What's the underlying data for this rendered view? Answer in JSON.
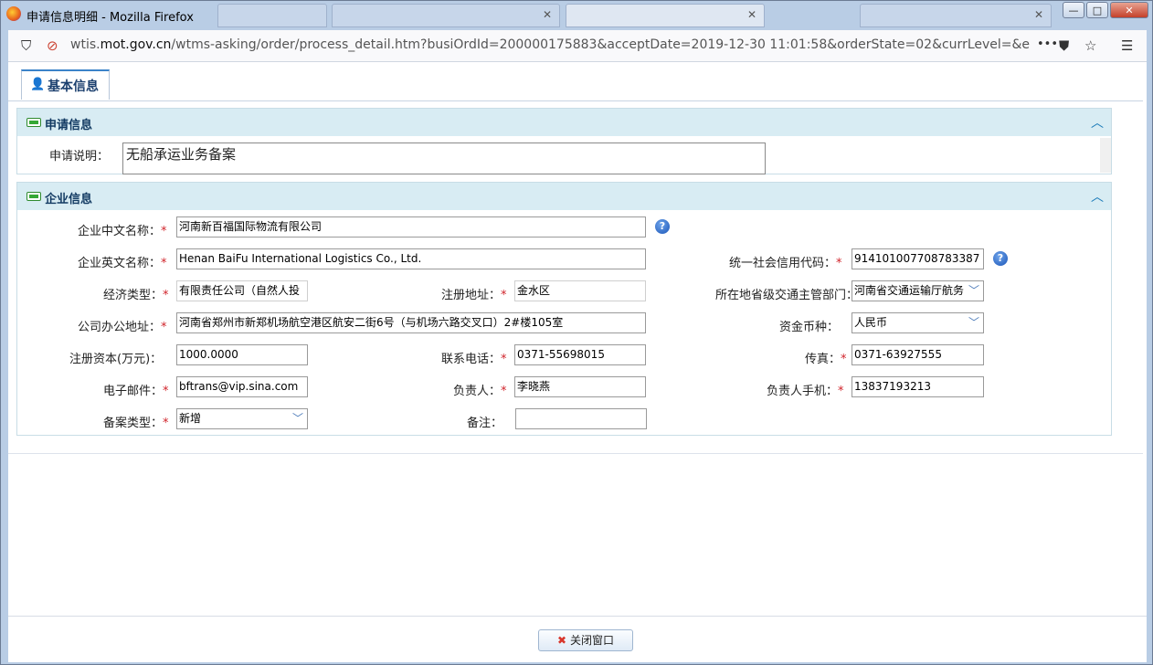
{
  "window": {
    "title": "申请信息明细 - Mozilla Firefox",
    "controls": {
      "minimize": "—",
      "maximize": "□",
      "close": "✕"
    }
  },
  "browser": {
    "url_prefix": "wtis.",
    "url_domain": "mot.gov.cn",
    "url_path": "/wtms-asking/order/process_detail.htm?busiOrdId=200000175883&acceptDate=2019-12-30 11:01:58&orderState=02&currLevel=&endLevel=",
    "more": "•••"
  },
  "tab": {
    "label": "基本信息"
  },
  "apply_panel": {
    "title": "申请信息",
    "remark_label": "申请说明：",
    "remark_value": "无船承运业务备案"
  },
  "company_panel": {
    "title": "企业信息",
    "fields": {
      "cn_name": {
        "label": "企业中文名称：",
        "value": "河南新百福国际物流有限公司"
      },
      "en_name": {
        "label": "企业英文名称：",
        "value": "Henan BaiFu International Logistics Co., Ltd."
      },
      "credit_code": {
        "label": "统一社会信用代码：",
        "value": "914101007708783387"
      },
      "econ_type": {
        "label": "经济类型：",
        "value": "有限责任公司（自然人投"
      },
      "reg_address": {
        "label": "注册地址：",
        "value": "金水区"
      },
      "authority": {
        "label": "所在地省级交通主管部门：",
        "value": "河南省交通运输厅航务"
      },
      "office_address": {
        "label": "公司办公地址：",
        "value": "河南省郑州市新郑机场航空港区航安二街6号（与机场六路交叉口）2#楼105室"
      },
      "currency": {
        "label": "资金币种：",
        "value": "人民币"
      },
      "capital": {
        "label": "注册资本(万元)：",
        "value": "1000.0000"
      },
      "phone": {
        "label": "联系电话：",
        "value": "0371-55698015"
      },
      "fax": {
        "label": "传真：",
        "value": "0371-63927555"
      },
      "email": {
        "label": "电子邮件：",
        "value": "bftrans@vip.sina.com"
      },
      "principal": {
        "label": "负责人：",
        "value": "李晓燕"
      },
      "principal_mobile": {
        "label": "负责人手机：",
        "value": "13837193213"
      },
      "filing_type": {
        "label": "备案类型：",
        "value": "新增"
      },
      "note": {
        "label": "备注：",
        "value": ""
      }
    }
  },
  "footer": {
    "close_label": "关闭窗口"
  },
  "colors": {
    "panel_head": "#d8ecf3",
    "tab_accent": "#3b83c9",
    "required": "#d0232a"
  },
  "icons": [
    "firefox-icon",
    "shield-icon",
    "tracking-icon",
    "pocket-icon",
    "bookmark-star-icon",
    "menu-icon",
    "user-icon",
    "help-icon",
    "chevron-up-icon",
    "close-x-icon"
  ]
}
